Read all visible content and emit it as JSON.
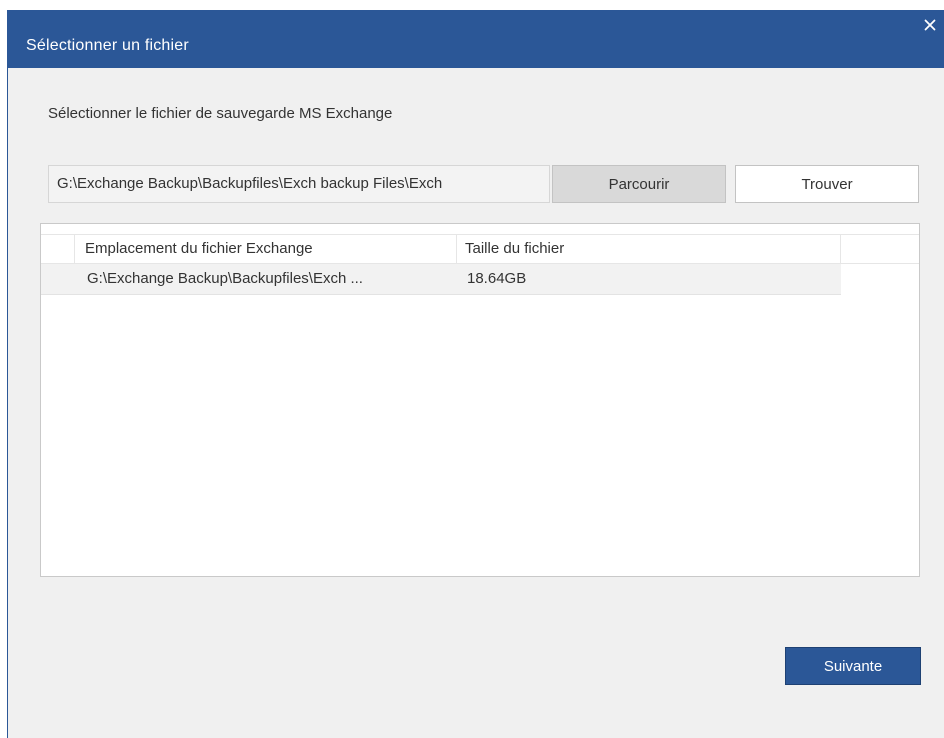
{
  "window": {
    "title": "Sélectionner un fichier",
    "close_icon": "close-icon"
  },
  "instruction": "Sélectionner le fichier de sauvegarde MS Exchange",
  "path_field": {
    "value": "G:\\Exchange Backup\\Backupfiles\\Exch backup Files\\Exch"
  },
  "buttons": {
    "browse": "Parcourir",
    "find": "Trouver",
    "next": "Suivante"
  },
  "table": {
    "columns": [
      "Emplacement du fichier Exchange",
      "Taille du fichier"
    ],
    "rows": [
      {
        "location": "G:\\Exchange Backup\\Backupfiles\\Exch ...",
        "size": "18.64GB",
        "expand_icon": "expand-arrow-icon"
      }
    ]
  },
  "colors": {
    "accent": "#2b5797",
    "background": "#f0f0f0"
  }
}
